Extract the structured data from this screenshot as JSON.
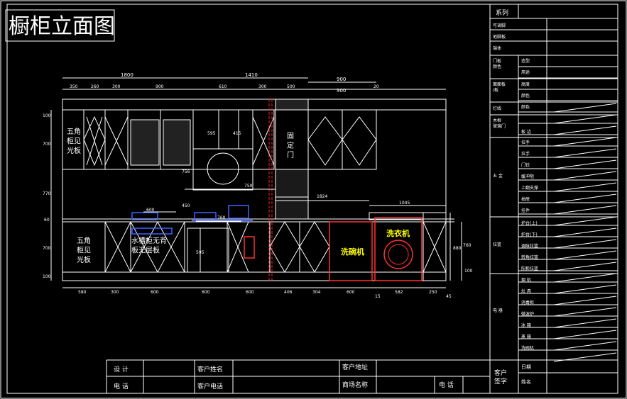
{
  "title": "橱柜立面图",
  "dims": {
    "top1": [
      "1800",
      "1410",
      "900"
    ],
    "top2": [
      "350",
      "260",
      "300",
      "900",
      "610",
      "300",
      "500",
      "900",
      "20"
    ],
    "left": [
      "100",
      "700",
      "770",
      "60",
      "700",
      "100"
    ],
    "bottom": [
      "580",
      "300",
      "600",
      "600",
      "600",
      "406",
      "304",
      "600",
      "15",
      "582",
      "250",
      "45"
    ],
    "inner": [
      "595",
      "415",
      "750",
      "1824",
      "1045",
      "600",
      "760",
      "450",
      "756",
      "595"
    ],
    "right": [
      "880",
      "760",
      "100"
    ]
  },
  "labels": {
    "upper_left": "五角\n柜见\n光板",
    "fixed_door": "固\n定\n门",
    "lower_left": "五角\n柜见\n光板",
    "sink": "水槽柜无背\n板无层板",
    "dishwasher": "洗碗机",
    "washer": "洗衣机"
  },
  "side_table": {
    "header": "系列",
    "rows_a": [
      "可调脚",
      "地脚板",
      "端体"
    ],
    "door_group": "门板\n颜色",
    "door_items": [
      "造型",
      "用途"
    ],
    "top_group": "面面板\n/板",
    "top_items": [
      "高度",
      "颜色"
    ],
    "light_group": "灯线",
    "light_items": [
      "颜色"
    ],
    "wood_group": "木框\n玻璃门",
    "wood_items": [
      "板 边"
    ],
    "hw_group": "五 金",
    "hw_items": [
      "拉手",
      "拉手",
      "门铰",
      "缓冲阻",
      "上翻支撑",
      "抽屉",
      "挂件"
    ],
    "bar_group": "拉篮",
    "bar_items": [
      "炉台(上)",
      "炉台(下)",
      "调味拉篮",
      "转角拉篮",
      "阳柜拉篮"
    ],
    "elec_group": "电 器",
    "elec_items": [
      "烟 机",
      "灶 具",
      "消毒柜",
      "微波炉",
      "冰 箱",
      "蒸 箱",
      "洗碗机"
    ]
  },
  "bottom_table": {
    "design": "设 计",
    "phone": "电 话",
    "cust_name": "客户姓名",
    "cust_phone": "客户电话",
    "cust_addr": "客户地址",
    "store_name": "商场名称",
    "phone2": "电 话",
    "sign": "客户\n签字",
    "date": "日期",
    "name": "姓名"
  }
}
